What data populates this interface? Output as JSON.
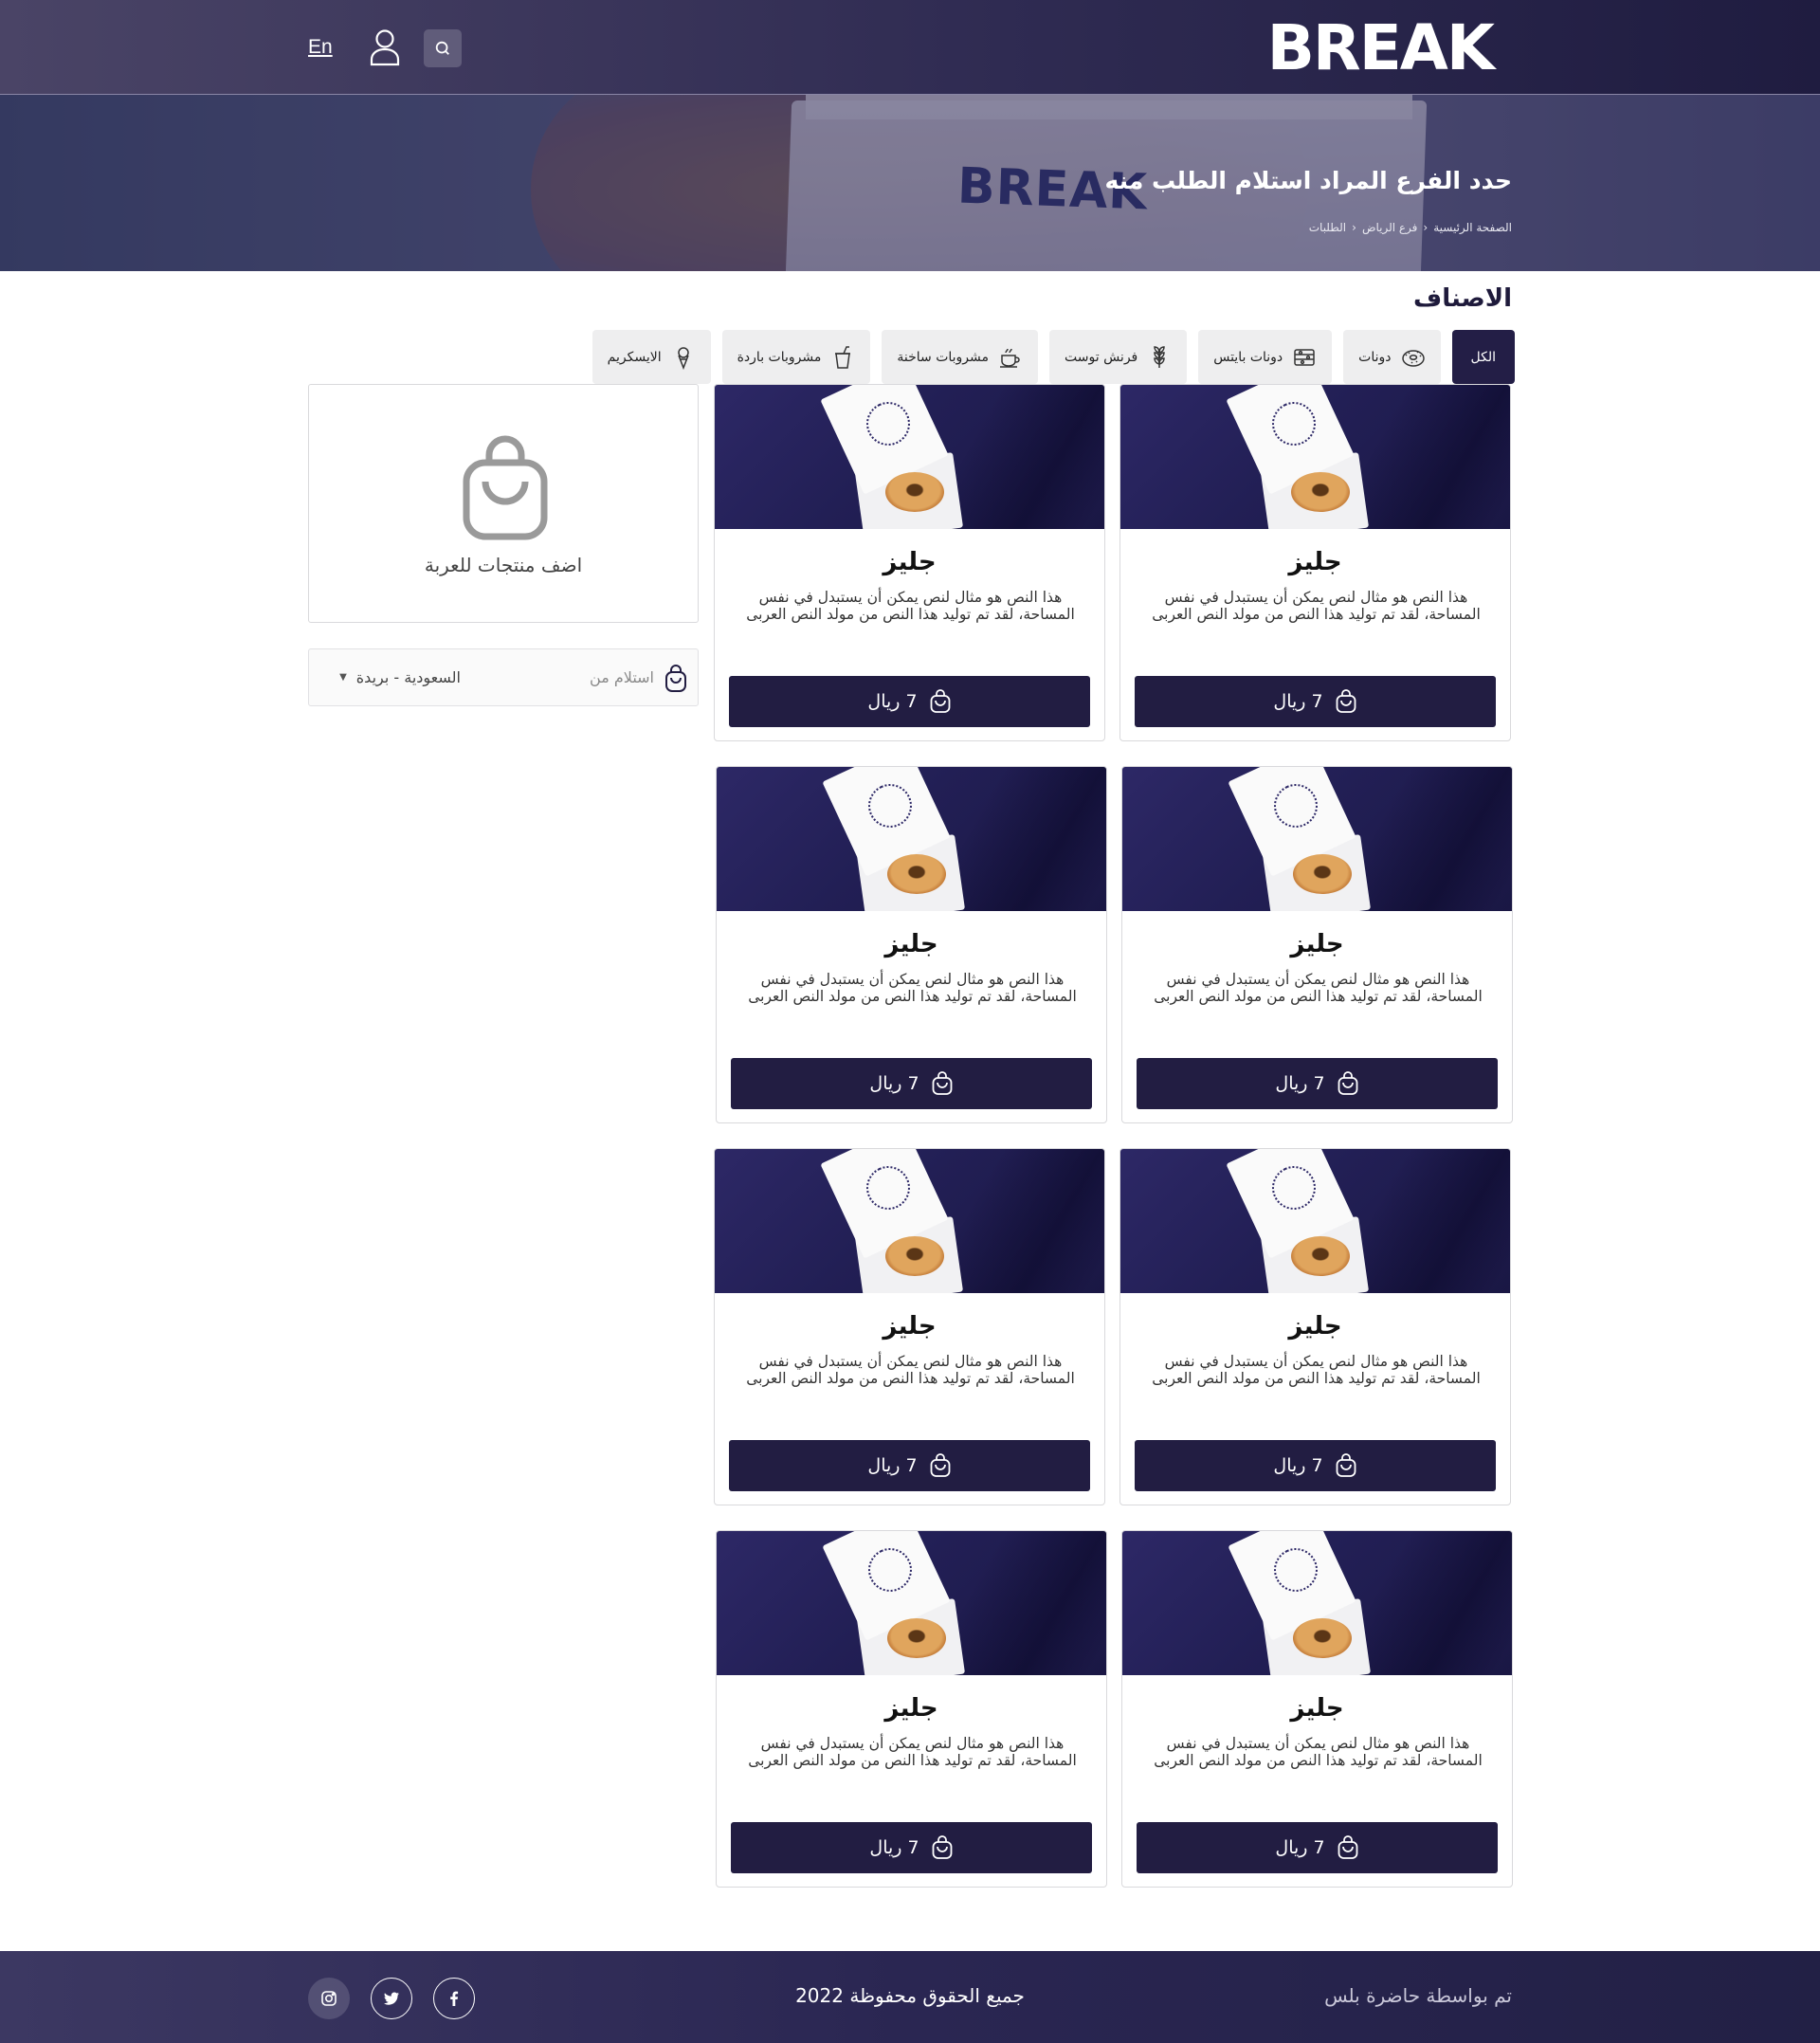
{
  "header": {
    "logo": "BREAK",
    "language_link": "En",
    "icons": [
      "search-icon",
      "user-icon"
    ]
  },
  "hero": {
    "title": "حدد الفرع المراد استلام الطلب منه",
    "breadcrumb": [
      "الصفحة الرئيسية",
      "فرع الرياض",
      "الطلبات"
    ],
    "box_brand": "BREAK"
  },
  "categories": {
    "title": "الاصناف",
    "tabs": [
      {
        "label": "الكل",
        "icon": "none",
        "active": true
      },
      {
        "label": "دونات",
        "icon": "donut-icon"
      },
      {
        "label": "دونات بايتس",
        "icon": "donut-bites-icon"
      },
      {
        "label": "فرنش توست",
        "icon": "wheat-icon"
      },
      {
        "label": "مشروبات ساخنة",
        "icon": "coffee-cup-icon"
      },
      {
        "label": "مشروبات باردة",
        "icon": "cold-drink-icon"
      },
      {
        "label": "الايسكريم",
        "icon": "ice-cream-icon"
      }
    ]
  },
  "products": [
    {
      "name": "جليز",
      "description": "هذا النص هو مثال لنص يمكن أن يستبدل في نفس المساحة، لقد تم توليد هذا النص من مولد النص العربى",
      "price": "7 ريال"
    },
    {
      "name": "جليز",
      "description": "هذا النص هو مثال لنص يمكن أن يستبدل في نفس المساحة، لقد تم توليد هذا النص من مولد النص العربى",
      "price": "7 ريال"
    },
    {
      "name": "جليز",
      "description": "هذا النص هو مثال لنص يمكن أن يستبدل في نفس المساحة، لقد تم توليد هذا النص من مولد النص العربى",
      "price": "7 ريال"
    },
    {
      "name": "جليز",
      "description": "هذا النص هو مثال لنص يمكن أن يستبدل في نفس المساحة، لقد تم توليد هذا النص من مولد النص العربى",
      "price": "7 ريال"
    },
    {
      "name": "جليز",
      "description": "هذا النص هو مثال لنص يمكن أن يستبدل في نفس المساحة، لقد تم توليد هذا النص من مولد النص العربى",
      "price": "7 ريال"
    },
    {
      "name": "جليز",
      "description": "هذا النص هو مثال لنص يمكن أن يستبدل في نفس المساحة، لقد تم توليد هذا النص من مولد النص العربى",
      "price": "7 ريال"
    },
    {
      "name": "جليز",
      "description": "هذا النص هو مثال لنص يمكن أن يستبدل في نفس المساحة، لقد تم توليد هذا النص من مولد النص العربى",
      "price": "7 ريال"
    },
    {
      "name": "جليز",
      "description": "هذا النص هو مثال لنص يمكن أن يستبدل في نفس المساحة، لقد تم توليد هذا النص من مولد النص العربى",
      "price": "7 ريال"
    }
  ],
  "cart": {
    "empty_text": "اضف منتجات للعربة",
    "pickup_label": "استلام من",
    "pickup_value": "السعودية - بريدة"
  },
  "footer": {
    "credit": "تم بواسطة حاضرة بلس",
    "copyright": "جميع الحقوق محفوظة 2022",
    "socials": [
      "facebook-icon",
      "twitter-icon",
      "instagram-icon"
    ]
  },
  "colors": {
    "primary": "#231e46",
    "header_bg": "#2f2b52",
    "tab_bg": "#eeeeef"
  }
}
